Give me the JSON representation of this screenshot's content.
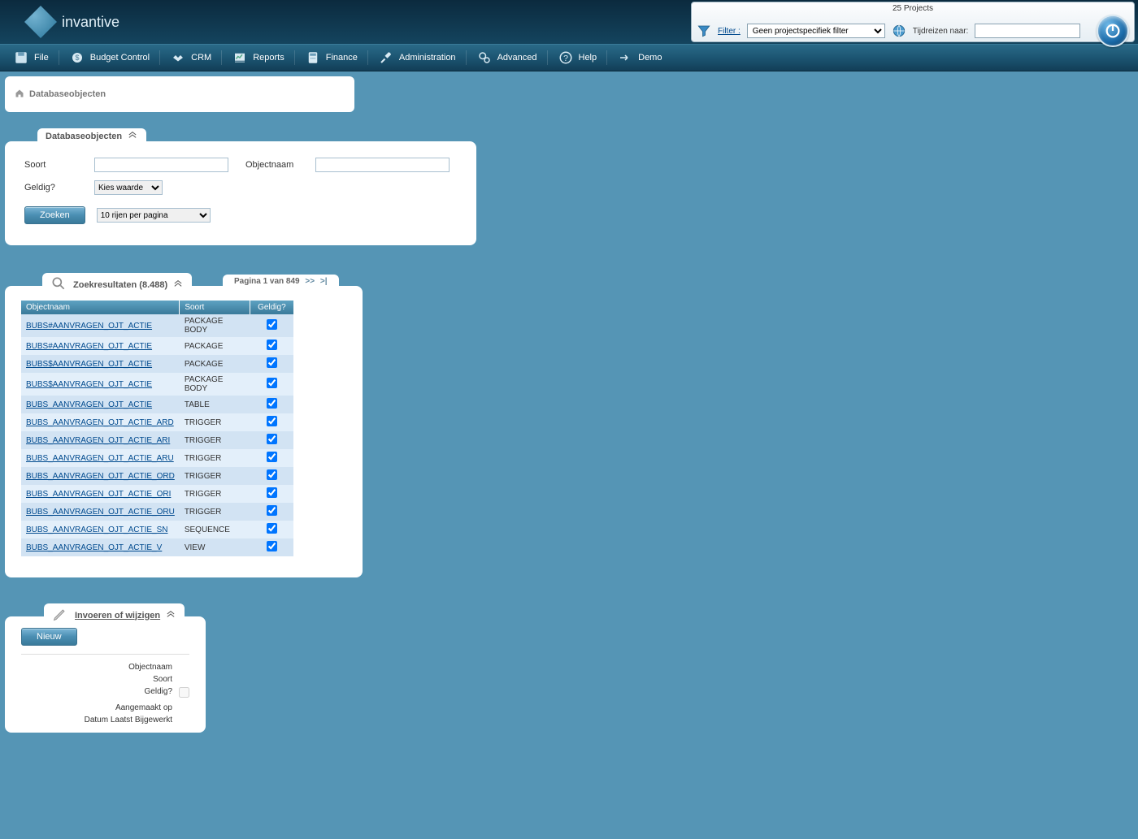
{
  "brand": "invantive",
  "header": {
    "project_count": "25 Projects",
    "filter_label": "Filter :",
    "filter_selected": "Geen projectspecifiek filter",
    "time_label": "Tijdreizen naar:",
    "time_value": ""
  },
  "toolbar": [
    {
      "label": "File"
    },
    {
      "label": "Budget Control"
    },
    {
      "label": "CRM"
    },
    {
      "label": "Reports"
    },
    {
      "label": "Finance"
    },
    {
      "label": "Administration"
    },
    {
      "label": "Advanced"
    },
    {
      "label": "Help"
    },
    {
      "label": "Demo"
    }
  ],
  "breadcrumb": "Databaseobjecten",
  "filter_panel": {
    "title": "Databaseobjecten",
    "labels": {
      "soort": "Soort",
      "objectnaam": "Objectnaam",
      "geldig": "Geldig?"
    },
    "geldig_selected": "Kies waarde",
    "search_btn": "Zoeken",
    "rows_per_page": "10 rijen per pagina"
  },
  "results": {
    "title": "Zoekresultaten (8.488)",
    "pagination": {
      "text": "Pagina 1 van 849",
      "next": ">>",
      "last": ">|"
    },
    "columns": {
      "objectnaam": "Objectnaam",
      "soort": "Soort",
      "geldig": "Geldig?"
    },
    "rows": [
      {
        "name": "BUBS#AANVRAGEN_OJT_ACTIE",
        "type": "PACKAGE BODY",
        "valid": true
      },
      {
        "name": "BUBS#AANVRAGEN_OJT_ACTIE",
        "type": "PACKAGE",
        "valid": true
      },
      {
        "name": "BUBS$AANVRAGEN_OJT_ACTIE",
        "type": "PACKAGE",
        "valid": true
      },
      {
        "name": "BUBS$AANVRAGEN_OJT_ACTIE",
        "type": "PACKAGE BODY",
        "valid": true
      },
      {
        "name": "BUBS_AANVRAGEN_OJT_ACTIE",
        "type": "TABLE",
        "valid": true
      },
      {
        "name": "BUBS_AANVRAGEN_OJT_ACTIE_ARD",
        "type": "TRIGGER",
        "valid": true
      },
      {
        "name": "BUBS_AANVRAGEN_OJT_ACTIE_ARI",
        "type": "TRIGGER",
        "valid": true
      },
      {
        "name": "BUBS_AANVRAGEN_OJT_ACTIE_ARU",
        "type": "TRIGGER",
        "valid": true
      },
      {
        "name": "BUBS_AANVRAGEN_OJT_ACTIE_ORD",
        "type": "TRIGGER",
        "valid": true
      },
      {
        "name": "BUBS_AANVRAGEN_OJT_ACTIE_ORI",
        "type": "TRIGGER",
        "valid": true
      },
      {
        "name": "BUBS_AANVRAGEN_OJT_ACTIE_ORU",
        "type": "TRIGGER",
        "valid": true
      },
      {
        "name": "BUBS_AANVRAGEN_OJT_ACTIE_SN",
        "type": "SEQUENCE",
        "valid": true
      },
      {
        "name": "BUBS_AANVRAGEN_OJT_ACTIE_V",
        "type": "VIEW",
        "valid": true
      }
    ]
  },
  "edit_panel": {
    "title": "Invoeren of wijzigen",
    "new_btn": "Nieuw",
    "labels": {
      "objectnaam": "Objectnaam",
      "soort": "Soort",
      "geldig": "Geldig?",
      "created": "Aangemaakt op",
      "updated": "Datum Laatst Bijgewerkt"
    }
  }
}
